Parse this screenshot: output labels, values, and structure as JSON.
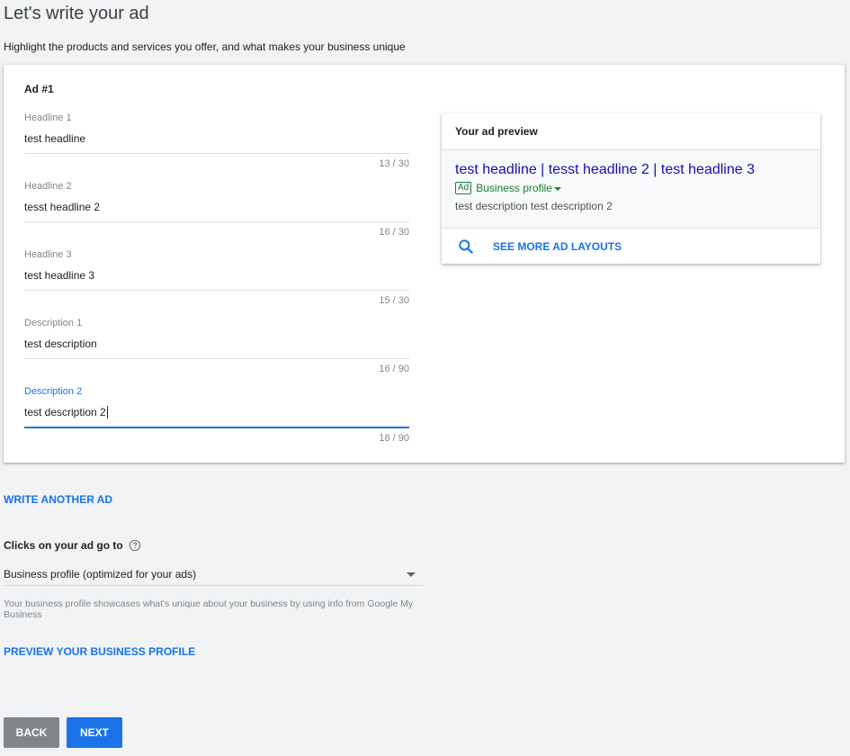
{
  "header": {
    "title": "Let's write your ad",
    "subtitle": "Highlight the products and services you offer, and what makes your business unique"
  },
  "ad": {
    "title": "Ad #1",
    "fields": [
      {
        "label": "Headline 1",
        "value": "test headline",
        "count": "13 / 30"
      },
      {
        "label": "Headline 2",
        "value": "tesst headline 2",
        "count": "16 / 30"
      },
      {
        "label": "Headline 3",
        "value": "test headline 3",
        "count": "15 / 30"
      },
      {
        "label": "Description 1",
        "value": "test description",
        "count": "16 / 90"
      },
      {
        "label": "Description 2",
        "value": "test description 2",
        "count": "18 / 90"
      }
    ]
  },
  "preview": {
    "title": "Your ad preview",
    "headline": "test headline | tesst headline 2 | test headline 3",
    "badge": "Ad",
    "url": "Business profile",
    "description": "test description test description 2",
    "see_more": "SEE MORE AD LAYOUTS",
    "headline_color": "#1a0dab",
    "url_color": "#188038",
    "icon": "search-icon"
  },
  "actions": {
    "write_another": "WRITE ANOTHER AD",
    "preview_profile": "PREVIEW YOUR BUSINESS PROFILE",
    "back": "BACK",
    "next": "NEXT"
  },
  "destination": {
    "label": "Clicks on your ad go to",
    "help_icon": "help-circle-icon",
    "selected": "Business profile (optimized for your ads)",
    "helper": "Your business profile showcases what's unique about your business by using info from Google My Business"
  },
  "colors": {
    "accent": "#1a73e8",
    "back_button": "#80868b",
    "background": "#f1f3f4"
  }
}
